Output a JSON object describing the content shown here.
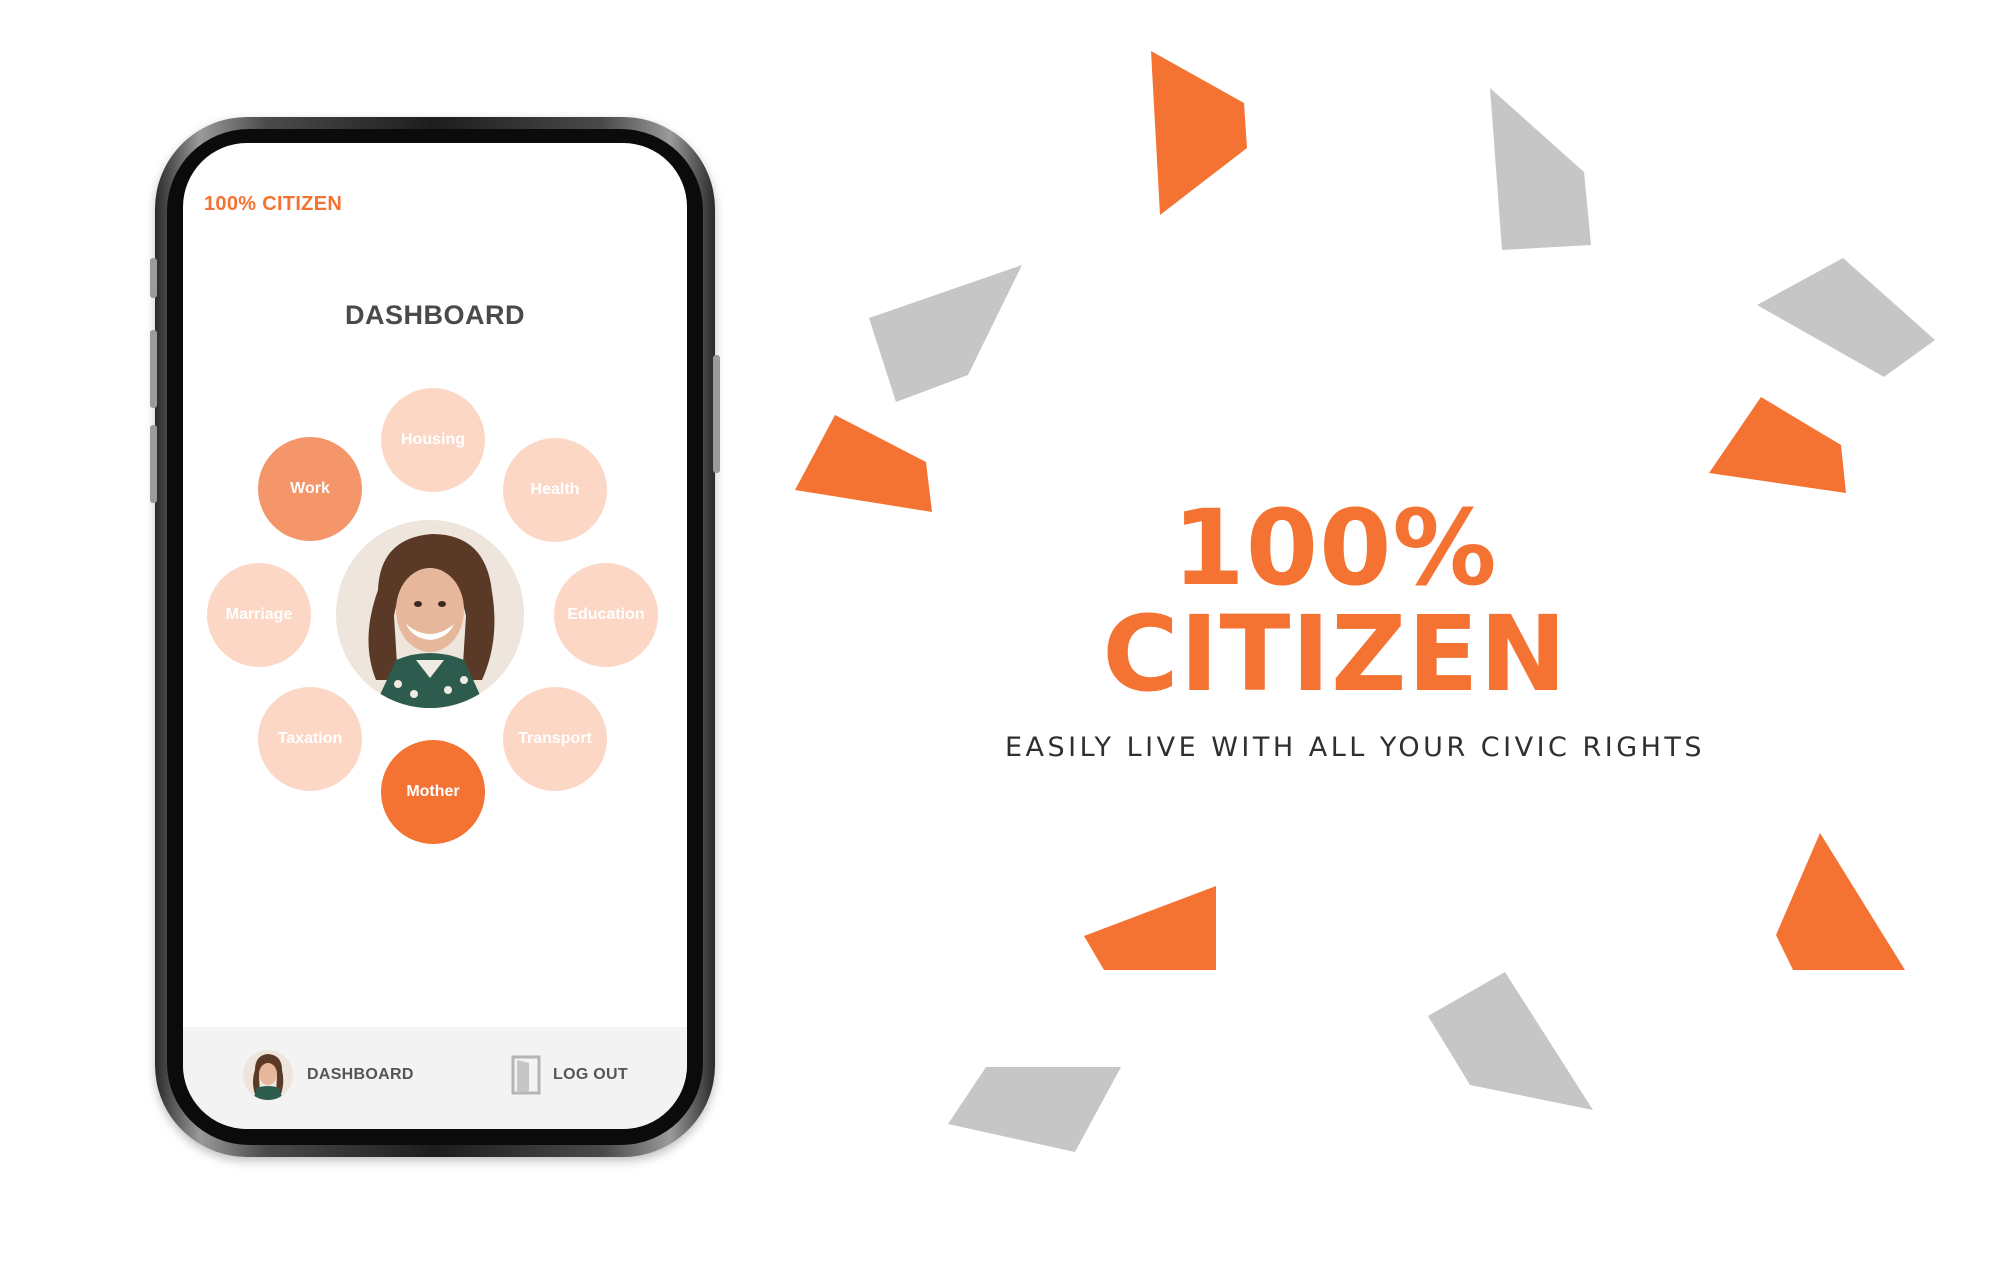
{
  "app": {
    "brand_label": "100% CITIZEN",
    "dashboard_heading": "DASHBOARD"
  },
  "dashboard": {
    "categories": [
      {
        "label": "Housing"
      },
      {
        "label": "Health"
      },
      {
        "label": "Work"
      },
      {
        "label": "Marriage"
      },
      {
        "label": "Education"
      },
      {
        "label": "Taxation"
      },
      {
        "label": "Transport"
      },
      {
        "label": "Mother"
      }
    ],
    "profile_icon": "user-photo"
  },
  "bottom_nav": {
    "dashboard_label": "DASHBOARD",
    "logout_label": "LOG OUT",
    "dashboard_icon": "avatar-icon",
    "logout_icon": "door-icon"
  },
  "hero": {
    "line1": "100%",
    "line2": "CITIZEN",
    "tagline": "EASILY LIVE WITH ALL YOUR CIVIC RIGHTS"
  },
  "colors": {
    "accent": "#f47332",
    "accent_mid": "#f5956a",
    "accent_light": "#fdd7c6",
    "shard_gray": "#c6c6c6",
    "text_dark": "#2f2f2f"
  }
}
